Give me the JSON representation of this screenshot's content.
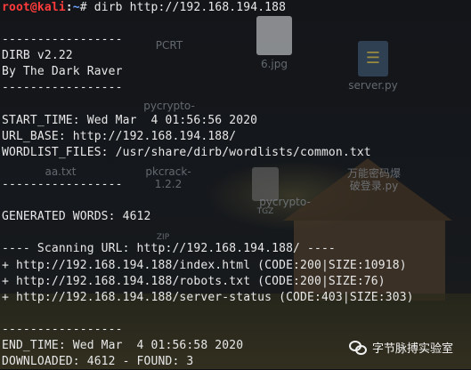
{
  "desktop": {
    "icons": [
      {
        "id": "pcrt",
        "label": "PCRT"
      },
      {
        "id": "jpg6",
        "label": "6.jpg"
      },
      {
        "id": "server",
        "label": "server.py"
      },
      {
        "id": "pycrypto1",
        "label": "pycrypto-"
      },
      {
        "id": "aa",
        "label": "aa.txt"
      },
      {
        "id": "pkcrack",
        "label": "pkcrack-"
      },
      {
        "id": "pkcrack_ver",
        "label": "1.2.2"
      },
      {
        "id": "tgz",
        "label": "TGZ"
      },
      {
        "id": "zip",
        "label": "ZIP"
      },
      {
        "id": "pycrypto2",
        "label": "pycrypto-"
      },
      {
        "id": "cn_py",
        "label": "万能密码爆"
      },
      {
        "id": "cn_py2",
        "label": "破登录.py"
      }
    ]
  },
  "terminal": {
    "prompt": {
      "user_host": "root@kali",
      "sep": ":",
      "path": "~",
      "symbol": "# ",
      "command": "dirb http://192.168.194.188"
    },
    "lines": [
      "",
      "-----------------",
      "DIRB v2.22",
      "By The Dark Raver",
      "-----------------",
      "",
      "START_TIME: Wed Mar  4 01:56:56 2020",
      "URL_BASE: http://192.168.194.188/",
      "WORDLIST_FILES: /usr/share/dirb/wordlists/common.txt",
      "",
      "-----------------",
      "",
      "GENERATED WORDS: 4612",
      "",
      "---- Scanning URL: http://192.168.194.188/ ----",
      "+ http://192.168.194.188/index.html (CODE:200|SIZE:10918)",
      "+ http://192.168.194.188/robots.txt (CODE:200|SIZE:76)",
      "+ http://192.168.194.188/server-status (CODE:403|SIZE:303)",
      "",
      "-----------------",
      "END_TIME: Wed Mar  4 01:56:58 2020",
      "DOWNLOADED: 4612 - FOUND: 3"
    ]
  },
  "watermark": {
    "text": "字节脉搏实验室",
    "icon": "wechat-icon"
  }
}
